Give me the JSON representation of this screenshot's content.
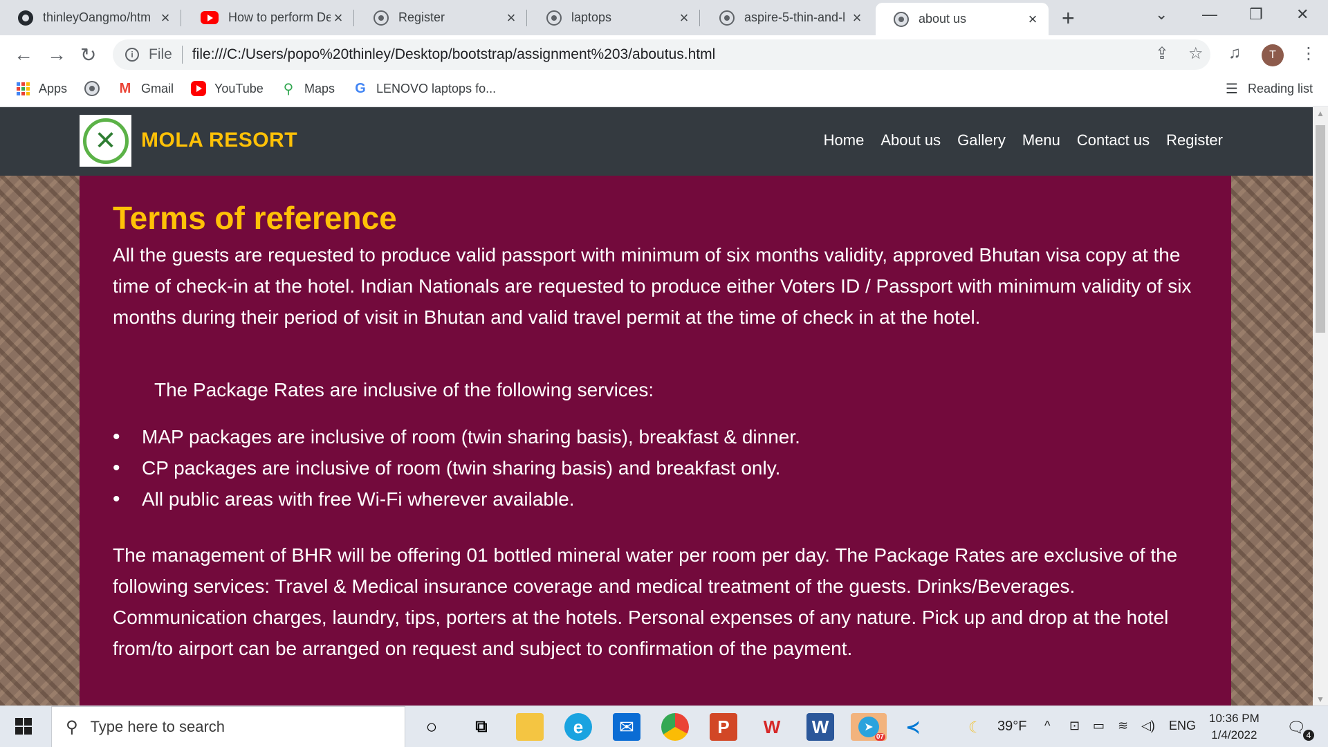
{
  "browser": {
    "tabs": [
      {
        "title": "thinleyOangmo/htm",
        "favicon": "github-icon"
      },
      {
        "title": "How to perform De",
        "favicon": "youtube-icon"
      },
      {
        "title": "Register",
        "favicon": "globe-icon"
      },
      {
        "title": "laptops",
        "favicon": "globe-icon"
      },
      {
        "title": "aspire-5-thin-and-l",
        "favicon": "globe-icon"
      },
      {
        "title": "about us",
        "favicon": "globe-icon",
        "active": true
      }
    ],
    "new_tab": "+",
    "address": {
      "scheme": "File",
      "url": "file:///C:/Users/popo%20thinley/Desktop/bootstrap/assignment%203/aboutus.html"
    },
    "profile_initial": "T",
    "bookmarks": [
      "Apps",
      "Gmail",
      "YouTube",
      "Maps",
      "LENOVO laptops fo..."
    ],
    "reading_list": "Reading list"
  },
  "site": {
    "brand": "MOLA RESORT",
    "nav": [
      "Home",
      "About us",
      "Gallery",
      "Menu",
      "Contact us",
      "Register"
    ],
    "heading": "Terms of reference",
    "intro": "All the guests are requested to produce valid passport with minimum of six months validity, approved Bhutan visa copy at the time of check-in at the hotel. Indian Nationals are requested to produce either Voters ID / Passport with minimum validity of six months during their period of visit in Bhutan and valid travel permit at the time of check in at the hotel.",
    "lead": "The Package Rates are inclusive of the following services:",
    "services": [
      "MAP packages are inclusive of room (twin sharing basis), breakfast & dinner.",
      "CP packages are inclusive of room (twin sharing basis) and breakfast only.",
      "All public areas with free Wi-Fi wherever available."
    ],
    "outro": "The management of BHR will be offering 01 bottled mineral water per room per day. The Package Rates are exclusive of the following services: Travel & Medical insurance coverage and medical treatment of the guests. Drinks/Beverages. Communication charges, laundry, tips, porters at the hotels. Personal expenses of any nature. Pick up and drop at the hotel from/to airport can be arranged on request and subject to confirmation of the payment.",
    "colors": {
      "nav_bg": "#343a40",
      "brand": "#ffc107",
      "content_bg": "#730a3c"
    }
  },
  "taskbar": {
    "search_placeholder": "Type here to search",
    "weather": "39°F",
    "language": "ENG",
    "time": "10:36 PM",
    "date": "1/4/2022",
    "notifications": "4",
    "telegram_badge": "07"
  }
}
